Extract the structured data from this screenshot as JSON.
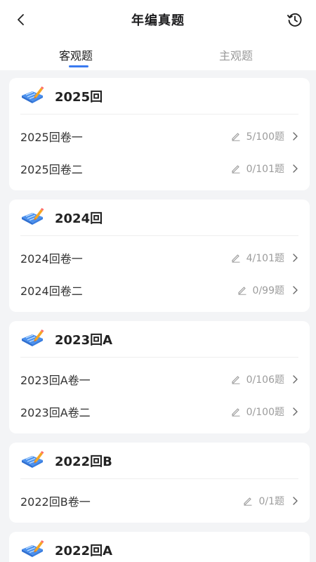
{
  "header": {
    "title": "年编真题"
  },
  "tabs": [
    {
      "label": "客观题"
    },
    {
      "label": "主观题"
    }
  ],
  "sections": [
    {
      "title": "2025回",
      "items": [
        {
          "label": "2025回卷一",
          "progress": "5/100题"
        },
        {
          "label": "2025回卷二",
          "progress": "0/101题"
        }
      ]
    },
    {
      "title": "2024回",
      "items": [
        {
          "label": "2024回卷一",
          "progress": "4/101题"
        },
        {
          "label": "2024回卷二",
          "progress": "0/99题"
        }
      ]
    },
    {
      "title": "2023回A",
      "items": [
        {
          "label": "2023回A卷一",
          "progress": "0/106题"
        },
        {
          "label": "2023回A卷二",
          "progress": "0/100题"
        }
      ]
    },
    {
      "title": "2022回B",
      "items": [
        {
          "label": "2022回B卷一",
          "progress": "0/1题"
        }
      ]
    },
    {
      "title": "2022回A",
      "items": []
    }
  ],
  "icons": {
    "back": "chevron-left-icon",
    "history": "history-icon",
    "section": "exam-paper-pencil-icon",
    "progress": "pencil-icon",
    "row_arrow": "chevron-right-icon"
  },
  "colors": {
    "accent": "#3a7af0",
    "background": "#f3f4f6"
  }
}
